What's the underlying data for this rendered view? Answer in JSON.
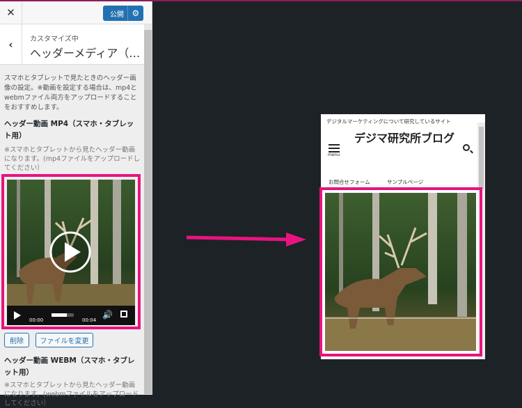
{
  "panel": {
    "close_icon": "close-icon",
    "publish_label": "公開",
    "gear_icon": "gear-icon",
    "breadcrumb": "カスタマイズ中",
    "section_title": "ヘッダーメディア（…",
    "description": "スマホとタブレットで見たときのヘッダー画像の設定。※動画を設定する場合は、mp4とwebmファイル両方をアップロードすることをおすすめします。",
    "mp4_label": "ヘッダー動画 MP4（スマホ・タブレット用）",
    "mp4_note": "※スマホとタブレットから見たヘッダー動画になります。(mp4ファイルをアップロードしてください）",
    "video": {
      "current_time": "00:00",
      "duration": "00:04",
      "progress": 0.69
    },
    "remove_button": "削除",
    "change_button": "ファイルを変更",
    "webm_label": "ヘッダー動画 WEBM（スマホ・タブレット用）",
    "webm_note": "※スマホとタブレットから見たヘッダー動画になります。(webmファイルをアップロードしてください）"
  },
  "preview": {
    "tagline": "デジタルマーケティングについて研究しているサイト",
    "site_title": "デジマ研究所ブログ",
    "menu_label": "menu",
    "nav_items": [
      "お問合せフォーム",
      "サンプルページ"
    ]
  },
  "colors": {
    "highlight": "#e8137e",
    "publish": "#2271b1",
    "background": "#1d2227"
  }
}
